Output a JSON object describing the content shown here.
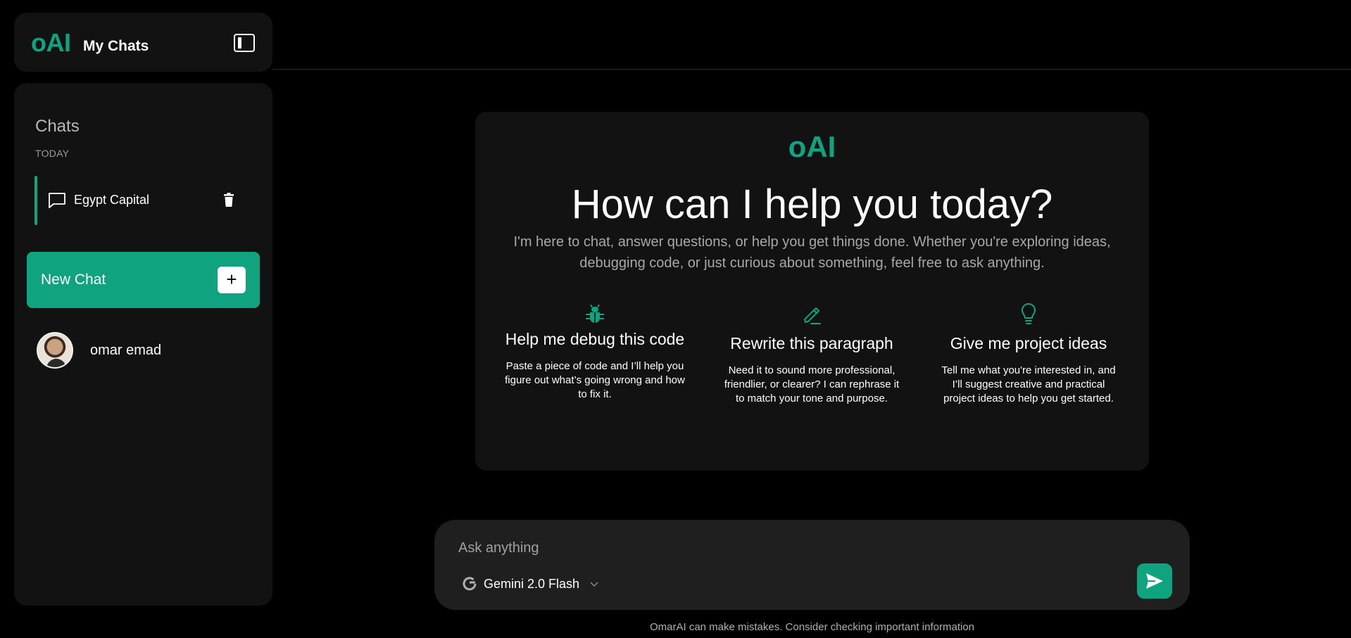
{
  "sidebar": {
    "logo": "oAI",
    "title": "My Chats",
    "section_title": "Chats",
    "group_label": "TODAY",
    "chats": [
      {
        "label": "Egypt Capital"
      }
    ],
    "new_chat_label": "New Chat",
    "user": {
      "name": "omar emad"
    }
  },
  "welcome": {
    "logo": "oAI",
    "title": "How can I help you today?",
    "subtitle": "I'm here to chat, answer questions, or help you get things done. Whether you're exploring ideas, debugging code, or just curious about something, feel free to ask anything.",
    "suggestions": [
      {
        "icon": "bug-icon",
        "title": "Help me debug this code",
        "description": "Paste a piece of code and I’ll help you figure out what’s going wrong and how to fix it."
      },
      {
        "icon": "pencil-icon",
        "title": "Rewrite this paragraph",
        "description": "Need it to sound more professional, friendlier, or clearer? I can rephrase it to match your tone and purpose."
      },
      {
        "icon": "lightbulb-icon",
        "title": "Give me project ideas",
        "description": "Tell me what you're interested in, and I’ll suggest creative and practical project ideas to help you get started."
      }
    ]
  },
  "composer": {
    "placeholder": "Ask anything",
    "value": "",
    "model": "Gemini 2.0 Flash"
  },
  "disclaimer": "OmarAI can make mistakes. Consider checking important information",
  "colors": {
    "accent": "#10a37f",
    "panel": "#121212",
    "composer": "#1f1f1f"
  }
}
